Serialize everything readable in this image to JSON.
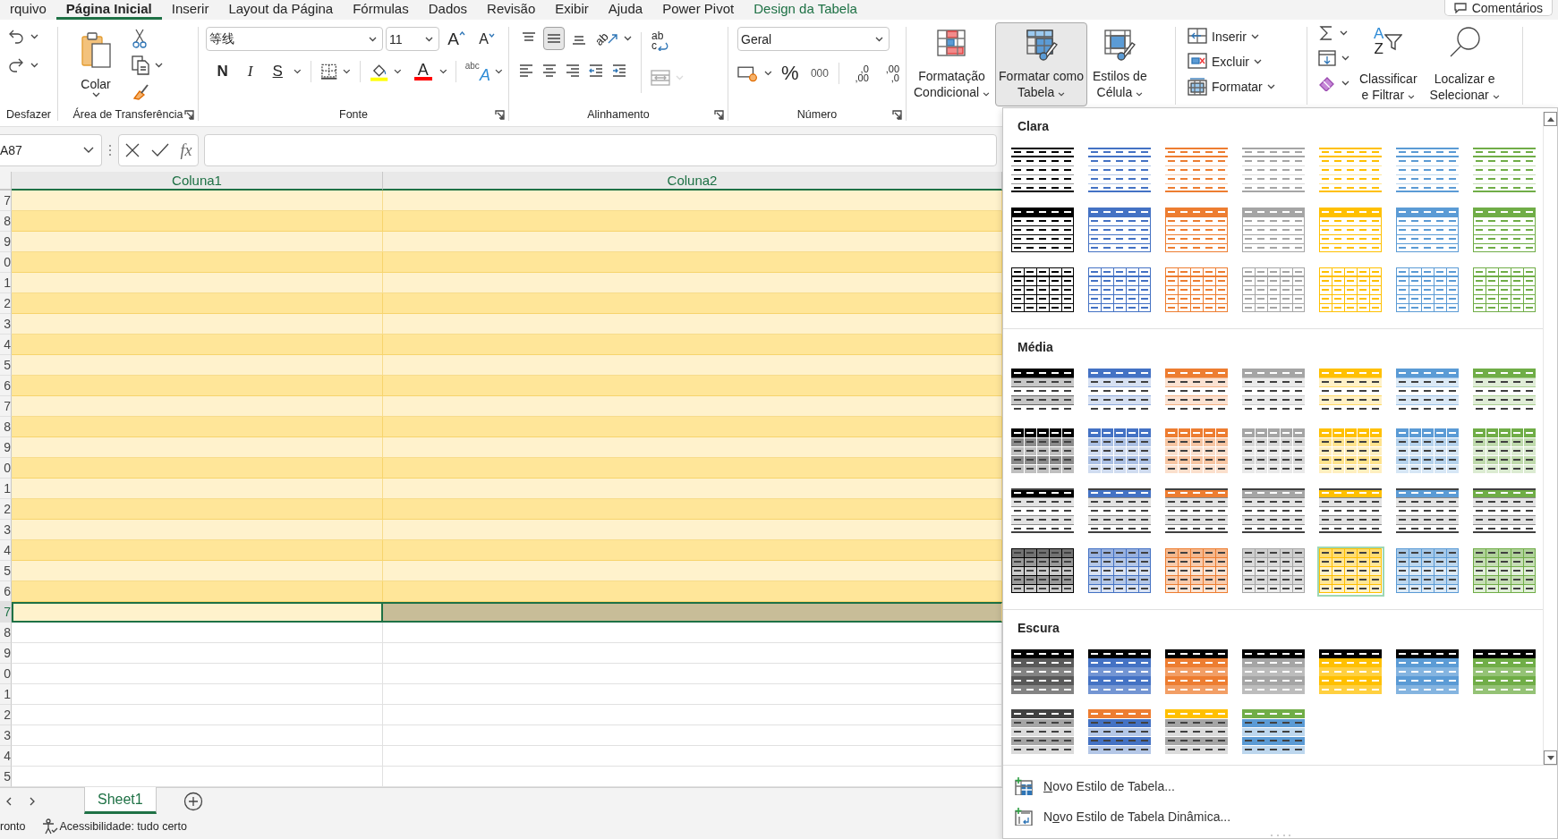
{
  "menu_tabs": [
    {
      "label": "rquivo",
      "selected": false,
      "kind": "normal"
    },
    {
      "label": "Página Inicial",
      "selected": true,
      "kind": "normal"
    },
    {
      "label": "Inserir",
      "selected": false,
      "kind": "normal"
    },
    {
      "label": "Layout da Página",
      "selected": false,
      "kind": "normal"
    },
    {
      "label": "Fórmulas",
      "selected": false,
      "kind": "normal"
    },
    {
      "label": "Dados",
      "selected": false,
      "kind": "normal"
    },
    {
      "label": "Revisão",
      "selected": false,
      "kind": "normal"
    },
    {
      "label": "Exibir",
      "selected": false,
      "kind": "normal"
    },
    {
      "label": "Ajuda",
      "selected": false,
      "kind": "normal"
    },
    {
      "label": "Power Pivot",
      "selected": false,
      "kind": "normal"
    },
    {
      "label": "Design da Tabela",
      "selected": false,
      "kind": "contextual"
    }
  ],
  "comments_button": "Comentários",
  "ribbon": {
    "undo": {
      "label": "Desfazer"
    },
    "clipboard": {
      "label": "Área de Transferência",
      "paste": "Colar"
    },
    "font": {
      "label": "Fonte",
      "font_name": "等线",
      "font_size": "11",
      "grow": "A",
      "shrink": "A",
      "bold": "N",
      "italic": "I",
      "underline": "S",
      "font_color": "A",
      "phonetic": "abc",
      "phonetic_letter": "A"
    },
    "alignment": {
      "label": "Alinhamento",
      "vertical_align": [
        {
          "selected": false
        },
        {
          "selected": true
        },
        {
          "selected": false
        }
      ],
      "orientation": "ab",
      "wrap": [
        "ab",
        "c"
      ],
      "merge": {
        "disabled": true
      }
    },
    "number": {
      "label": "Número",
      "format": "Geral",
      "percent": "%",
      "thousands": "000",
      "increase_decimal": [
        ",0",
        ",00"
      ],
      "decrease_decimal": [
        ",00",
        ",0"
      ]
    },
    "styles": [
      {
        "lines": [
          "Formatação",
          "Condicional"
        ],
        "selected": false
      },
      {
        "lines": [
          "Formatar como",
          "Tabela"
        ],
        "selected": true
      },
      {
        "lines": [
          "Estilos de",
          "Célula"
        ],
        "selected": false
      }
    ],
    "cells": [
      {
        "label": "Inserir"
      },
      {
        "label": "Excluir"
      },
      {
        "label": "Formatar"
      }
    ],
    "editing": {
      "sort_letters": [
        "A",
        "Z"
      ],
      "sort": [
        "Classificar",
        "e Filtrar"
      ],
      "find": [
        "Localizar e",
        "Selecionar"
      ]
    }
  },
  "formula_bar": {
    "name_box": "A87",
    "function_label": "fx"
  },
  "sheet": {
    "columns": [
      "Coluna1",
      "Coluna2"
    ],
    "rows": [
      {
        "number": "7",
        "kind": "band-light",
        "selected": false
      },
      {
        "number": "8",
        "kind": "band-dark",
        "selected": false
      },
      {
        "number": "9",
        "kind": "band-light",
        "selected": false
      },
      {
        "number": "0",
        "kind": "band-dark",
        "selected": false
      },
      {
        "number": "1",
        "kind": "band-light",
        "selected": false
      },
      {
        "number": "2",
        "kind": "band-dark",
        "selected": false
      },
      {
        "number": "3",
        "kind": "band-light",
        "selected": false
      },
      {
        "number": "4",
        "kind": "band-dark",
        "selected": false
      },
      {
        "number": "5",
        "kind": "band-light",
        "selected": false
      },
      {
        "number": "6",
        "kind": "band-dark",
        "selected": false
      },
      {
        "number": "7",
        "kind": "band-light",
        "selected": false
      },
      {
        "number": "8",
        "kind": "band-dark",
        "selected": false
      },
      {
        "number": "9",
        "kind": "band-light",
        "selected": false
      },
      {
        "number": "0",
        "kind": "band-dark",
        "selected": false
      },
      {
        "number": "1",
        "kind": "band-light",
        "selected": false
      },
      {
        "number": "2",
        "kind": "band-dark",
        "selected": false
      },
      {
        "number": "3",
        "kind": "band-light",
        "selected": false
      },
      {
        "number": "4",
        "kind": "band-dark",
        "selected": false
      },
      {
        "number": "5",
        "kind": "band-light",
        "selected": false
      },
      {
        "number": "6",
        "kind": "band-dark",
        "selected": false
      },
      {
        "number": "7",
        "kind": "band-light",
        "selected": true
      },
      {
        "number": "8",
        "kind": "plain",
        "selected": false
      },
      {
        "number": "9",
        "kind": "plain",
        "selected": false
      },
      {
        "number": "0",
        "kind": "plain",
        "selected": false
      },
      {
        "number": "1",
        "kind": "plain",
        "selected": false
      },
      {
        "number": "2",
        "kind": "plain",
        "selected": false
      },
      {
        "number": "3",
        "kind": "plain",
        "selected": false
      },
      {
        "number": "4",
        "kind": "plain",
        "selected": false
      },
      {
        "number": "5",
        "kind": "plain",
        "selected": false
      }
    ]
  },
  "sheet_tabs": [
    {
      "label": "Sheet1",
      "selected": true
    }
  ],
  "status_bar": {
    "mode": "ronto",
    "accessibility": "Acessibilidade: tudo certo"
  },
  "gallery": {
    "sections": [
      {
        "title": "Clara",
        "styles": [
          {
            "kind": "light-lines",
            "color": "#000000",
            "selected": false
          },
          {
            "kind": "light-lines",
            "color": "#4472c4",
            "selected": false
          },
          {
            "kind": "light-lines",
            "color": "#ed7d31",
            "selected": false
          },
          {
            "kind": "light-lines",
            "color": "#a5a5a5",
            "selected": false
          },
          {
            "kind": "light-lines",
            "color": "#ffc000",
            "selected": false
          },
          {
            "kind": "light-lines",
            "color": "#5b9bd5",
            "selected": false
          },
          {
            "kind": "light-lines",
            "color": "#70ad47",
            "selected": false
          },
          {
            "kind": "light-header",
            "color": "#000000",
            "selected": false
          },
          {
            "kind": "light-header",
            "color": "#4472c4",
            "selected": false
          },
          {
            "kind": "light-header",
            "color": "#ed7d31",
            "selected": false
          },
          {
            "kind": "light-header",
            "color": "#a5a5a5",
            "selected": false
          },
          {
            "kind": "light-header",
            "color": "#ffc000",
            "selected": false
          },
          {
            "kind": "light-header",
            "color": "#5b9bd5",
            "selected": false
          },
          {
            "kind": "light-header",
            "color": "#70ad47",
            "selected": false
          },
          {
            "kind": "light-grid",
            "color": "#000000",
            "selected": false
          },
          {
            "kind": "light-grid",
            "color": "#4472c4",
            "selected": false
          },
          {
            "kind": "light-grid",
            "color": "#ed7d31",
            "selected": false
          },
          {
            "kind": "light-grid",
            "color": "#a5a5a5",
            "selected": false
          },
          {
            "kind": "light-grid",
            "color": "#ffc000",
            "selected": false
          },
          {
            "kind": "light-grid",
            "color": "#5b9bd5",
            "selected": false
          },
          {
            "kind": "light-grid",
            "color": "#70ad47",
            "selected": false
          }
        ]
      },
      {
        "title": "Média",
        "styles": [
          {
            "kind": "medium-banded",
            "color": "#000000",
            "selected": false
          },
          {
            "kind": "medium-banded",
            "color": "#4472c4",
            "selected": false
          },
          {
            "kind": "medium-banded",
            "color": "#ed7d31",
            "selected": false
          },
          {
            "kind": "medium-banded",
            "color": "#a5a5a5",
            "selected": false
          },
          {
            "kind": "medium-banded",
            "color": "#ffc000",
            "selected": false
          },
          {
            "kind": "medium-banded",
            "color": "#5b9bd5",
            "selected": false
          },
          {
            "kind": "medium-banded",
            "color": "#70ad47",
            "selected": false
          },
          {
            "kind": "medium-grid-header",
            "color": "#000000",
            "selected": false
          },
          {
            "kind": "medium-grid-header",
            "color": "#4472c4",
            "selected": false
          },
          {
            "kind": "medium-grid-header",
            "color": "#ed7d31",
            "selected": false
          },
          {
            "kind": "medium-grid-header",
            "color": "#a5a5a5",
            "selected": false
          },
          {
            "kind": "medium-grid-header",
            "color": "#ffc000",
            "selected": false
          },
          {
            "kind": "medium-grid-header",
            "color": "#5b9bd5",
            "selected": false
          },
          {
            "kind": "medium-grid-header",
            "color": "#70ad47",
            "selected": false
          },
          {
            "kind": "medium-dark-header",
            "color": "#000000",
            "selected": false
          },
          {
            "kind": "medium-dark-header",
            "color": "#4472c4",
            "selected": false
          },
          {
            "kind": "medium-dark-header",
            "color": "#ed7d31",
            "selected": false
          },
          {
            "kind": "medium-dark-header",
            "color": "#a5a5a5",
            "selected": false
          },
          {
            "kind": "medium-dark-header",
            "color": "#ffc000",
            "selected": false
          },
          {
            "kind": "medium-dark-header",
            "color": "#5b9bd5",
            "selected": false
          },
          {
            "kind": "medium-dark-header",
            "color": "#70ad47",
            "selected": false
          },
          {
            "kind": "medium-grid",
            "color": "#000000",
            "selected": false
          },
          {
            "kind": "medium-grid",
            "color": "#4472c4",
            "selected": false
          },
          {
            "kind": "medium-grid",
            "color": "#ed7d31",
            "selected": false
          },
          {
            "kind": "medium-grid",
            "color": "#a5a5a5",
            "selected": false
          },
          {
            "kind": "medium-grid",
            "color": "#ffc000",
            "selected": true
          },
          {
            "kind": "medium-grid",
            "color": "#5b9bd5",
            "selected": false
          },
          {
            "kind": "medium-grid",
            "color": "#70ad47",
            "selected": false
          }
        ]
      },
      {
        "title": "Escura",
        "styles": [
          {
            "kind": "dark",
            "color": "#595959",
            "selected": false
          },
          {
            "kind": "dark",
            "color": "#4472c4",
            "selected": false
          },
          {
            "kind": "dark",
            "color": "#ed7d31",
            "selected": false
          },
          {
            "kind": "dark",
            "color": "#a5a5a5",
            "selected": false
          },
          {
            "kind": "dark",
            "color": "#ffc000",
            "selected": false
          },
          {
            "kind": "dark",
            "color": "#5b9bd5",
            "selected": false
          },
          {
            "kind": "dark",
            "color": "#70ad47",
            "selected": false
          },
          {
            "kind": "dark-light",
            "color": "#a5a5a5",
            "header": {
              "color": "#404040"
            },
            "selected": false
          },
          {
            "kind": "dark-light",
            "color": "#4472c4",
            "header": {
              "color": "#ed7d31"
            },
            "selected": false
          },
          {
            "kind": "dark-light",
            "color": "#a5a5a5",
            "header": {
              "color": "#ffc000"
            },
            "selected": false
          },
          {
            "kind": "dark-light",
            "color": "#5b9bd5",
            "header": {
              "color": "#70ad47"
            },
            "selected": false
          }
        ]
      }
    ],
    "actions": [
      {
        "kind": "table",
        "access_key": "N",
        "label_rest": "ovo Estilo de Tabela..."
      },
      {
        "kind": "pivot",
        "label_start": "N",
        "access_key": "o",
        "label_rest": "vo Estilo de Tabela Dinâmica..."
      }
    ]
  }
}
